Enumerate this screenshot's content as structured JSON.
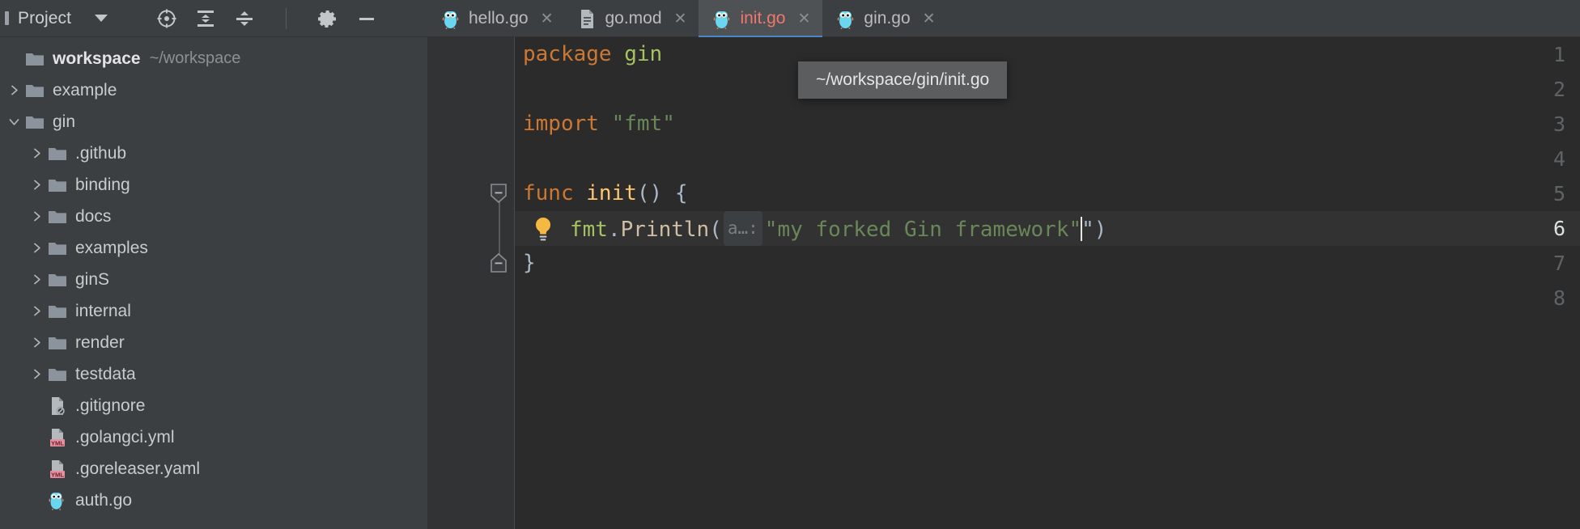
{
  "toolbar": {
    "project_label": "Project",
    "dropdown_icon": "chevron-down-icon",
    "buttons": [
      {
        "name": "select-opened-file-button",
        "icon": "crosshair-target-icon",
        "label": "Select Opened File"
      },
      {
        "name": "expand-all-button",
        "icon": "expand-all-icon",
        "label": "Expand All"
      },
      {
        "name": "collapse-all-button",
        "icon": "collapse-all-icon",
        "label": "Collapse All"
      },
      {
        "name": "settings-button",
        "icon": "gear-icon",
        "label": "Settings"
      },
      {
        "name": "hide-button",
        "icon": "minimize-icon",
        "label": "Hide"
      }
    ]
  },
  "tabs": [
    {
      "label": "hello.go",
      "icon": "go-gopher-icon",
      "active": false,
      "close_icon": "close-icon"
    },
    {
      "label": "go.mod",
      "icon": "go-mod-file-icon",
      "active": false,
      "close_icon": "close-icon"
    },
    {
      "label": "init.go",
      "icon": "go-gopher-icon",
      "active": true,
      "close_icon": "close-icon"
    },
    {
      "label": "gin.go",
      "icon": "go-gopher-icon",
      "active": false,
      "close_icon": "close-icon"
    }
  ],
  "tree": [
    {
      "label": "workspace",
      "secondary": "~/workspace",
      "icon": "folder-icon",
      "depth": 0,
      "arrow": "none",
      "bold": true
    },
    {
      "label": "example",
      "secondary": "",
      "icon": "folder-icon",
      "depth": 0,
      "arrow": "collapsed",
      "bold": false
    },
    {
      "label": "gin",
      "secondary": "",
      "icon": "folder-icon",
      "depth": 0,
      "arrow": "expanded",
      "bold": false
    },
    {
      "label": ".github",
      "secondary": "",
      "icon": "folder-icon",
      "depth": 1,
      "arrow": "collapsed",
      "bold": false
    },
    {
      "label": "binding",
      "secondary": "",
      "icon": "folder-icon",
      "depth": 1,
      "arrow": "collapsed",
      "bold": false
    },
    {
      "label": "docs",
      "secondary": "",
      "icon": "folder-icon",
      "depth": 1,
      "arrow": "collapsed",
      "bold": false
    },
    {
      "label": "examples",
      "secondary": "",
      "icon": "folder-icon",
      "depth": 1,
      "arrow": "collapsed",
      "bold": false
    },
    {
      "label": "ginS",
      "secondary": "",
      "icon": "folder-icon",
      "depth": 1,
      "arrow": "collapsed",
      "bold": false
    },
    {
      "label": "internal",
      "secondary": "",
      "icon": "folder-icon",
      "depth": 1,
      "arrow": "collapsed",
      "bold": false
    },
    {
      "label": "render",
      "secondary": "",
      "icon": "folder-icon",
      "depth": 1,
      "arrow": "collapsed",
      "bold": false
    },
    {
      "label": "testdata",
      "secondary": "",
      "icon": "folder-icon",
      "depth": 1,
      "arrow": "collapsed",
      "bold": false
    },
    {
      "label": ".gitignore",
      "secondary": "",
      "icon": "gitignore-file-icon",
      "depth": 1,
      "arrow": "none",
      "bold": false
    },
    {
      "label": ".golangci.yml",
      "secondary": "",
      "icon": "yml-file-icon",
      "depth": 1,
      "arrow": "none",
      "bold": false
    },
    {
      "label": ".goreleaser.yaml",
      "secondary": "",
      "icon": "yml-file-icon",
      "depth": 1,
      "arrow": "none",
      "bold": false
    },
    {
      "label": "auth.go",
      "secondary": "",
      "icon": "go-gopher-icon",
      "depth": 1,
      "arrow": "none",
      "bold": false
    }
  ],
  "editor": {
    "line_numbers": [
      "1",
      "2",
      "3",
      "4",
      "5",
      "6",
      "7",
      "8"
    ],
    "caret_line": 6,
    "lines": {
      "l1": {
        "kw": "package",
        "name": "gin"
      },
      "l3": {
        "kw": "import",
        "str": "\"fmt\""
      },
      "l5": {
        "kw": "func",
        "fn": "init",
        "paren": "()",
        "brace": "{"
      },
      "l6": {
        "recv": "fmt",
        "dot": ".",
        "method": "Println",
        "open": "(",
        "hint": "a…:",
        "str": "\"my forked Gin framework\"",
        "close": "\")"
      },
      "l7": {
        "brace": "}"
      }
    },
    "bulb_icon": "intention-bulb-icon",
    "fold_icons": [
      "fold-collapse-start-icon",
      "fold-collapse-end-icon"
    ]
  },
  "tooltip": {
    "text": "~/workspace/gin/init.go"
  },
  "colors": {
    "panel_bg": "#3c3f41",
    "editor_bg": "#2b2b2b",
    "gutter_bg": "#313335",
    "caret_line_bg": "#323232",
    "active_tab_bg": "#4e5254",
    "active_tab_underline": "#4a88c7",
    "active_tab_text": "#f0776c",
    "keyword": "#cc7832",
    "string": "#6a8759",
    "function": "#ffc66d",
    "identifier": "#a9b7c6",
    "yml_badge": "#e58fa0",
    "gopher_blue": "#6ad7f0"
  }
}
